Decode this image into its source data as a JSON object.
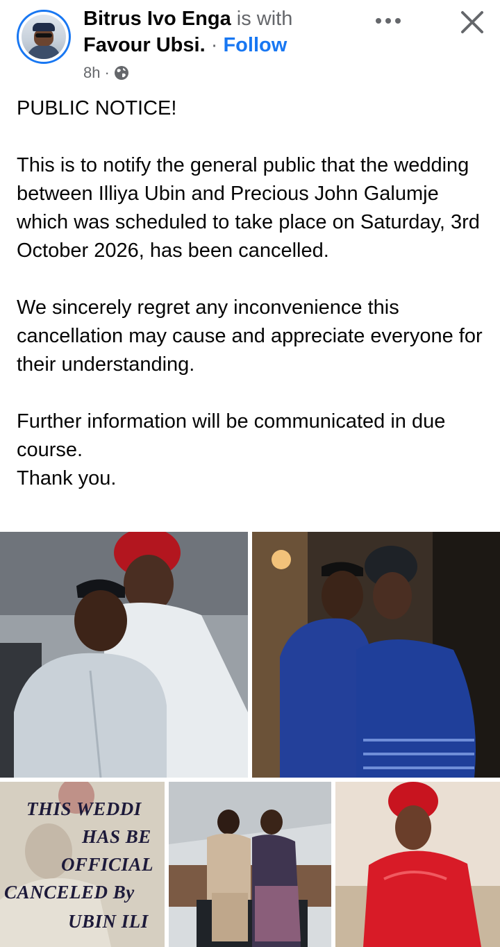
{
  "post": {
    "author": "Bitrus Ivo Enga",
    "with_text": "is with",
    "tagged": "Favour Ubsi.",
    "separator": "·",
    "follow_label": "Follow",
    "time": "8h",
    "time_separator": "·",
    "privacy_icon": "globe-icon",
    "more_icon": "more-horizontal-icon",
    "close_icon": "close-icon"
  },
  "body": {
    "headline": "PUBLIC NOTICE!",
    "para1": "This is to notify the general public that the wedding between Illiya Ubin and Precious John Galumje which was scheduled to take place on Saturday, 3rd October 2026, has been cancelled.",
    "para2": "We sincerely regret any inconvenience this cancellation may cause and appreciate everyone for their understanding.",
    "para3": "Further information will be communicated in due course.",
    "closing": "Thank you."
  },
  "photos": {
    "notice_lines": [
      "THIS WEDDI",
      "HAS BE",
      "OFFICIAL",
      "CANCELED By",
      "UBIN ILI"
    ]
  },
  "colors": {
    "accent": "#1877f2",
    "text": "#050505",
    "muted": "#65676b"
  }
}
